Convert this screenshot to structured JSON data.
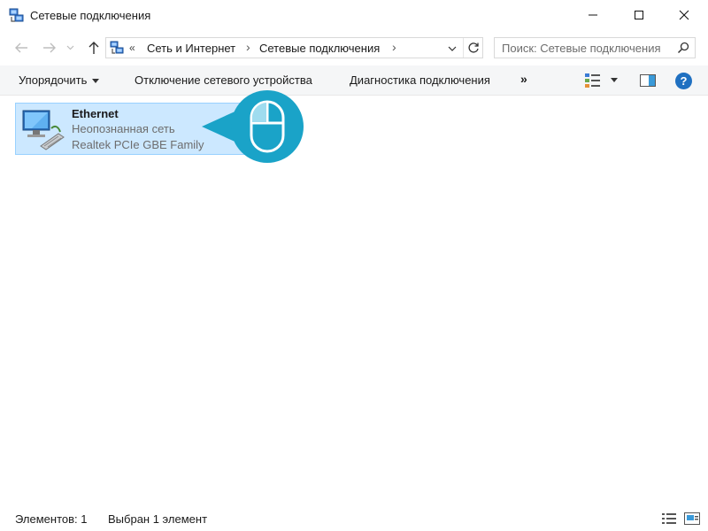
{
  "window": {
    "title": "Сетевые подключения"
  },
  "address": {
    "overflow": "«",
    "crumbs": [
      "Сеть и Интернет",
      "Сетевые подключения"
    ],
    "separator": "›"
  },
  "search": {
    "placeholder": "Поиск: Сетевые подключения"
  },
  "toolbar": {
    "organize_label": "Упорядочить",
    "disable_label": "Отключение сетевого устройства",
    "diagnose_label": "Диагностика подключения",
    "more_label": "»",
    "help_label": "?"
  },
  "connections": [
    {
      "name": "Ethernet",
      "status": "Неопознанная сеть",
      "device": "Realtek PCIe GBE Family",
      "selected": true
    }
  ],
  "statusbar": {
    "count_label": "Элементов: 1",
    "selected_label": "Выбран 1 элемент"
  },
  "colors": {
    "selection_bg": "#cce8ff",
    "selection_border": "#99d1ff",
    "callout": "#1aa3c8",
    "help": "#1f70c1"
  },
  "icons": {
    "app": "network-connections-icon",
    "back": "arrow-left-icon",
    "forward": "arrow-right-icon",
    "up": "arrow-up-icon",
    "refresh": "refresh-icon",
    "search": "search-icon",
    "item": "ethernet-adapter-icon",
    "callout": "mouse-icon"
  }
}
